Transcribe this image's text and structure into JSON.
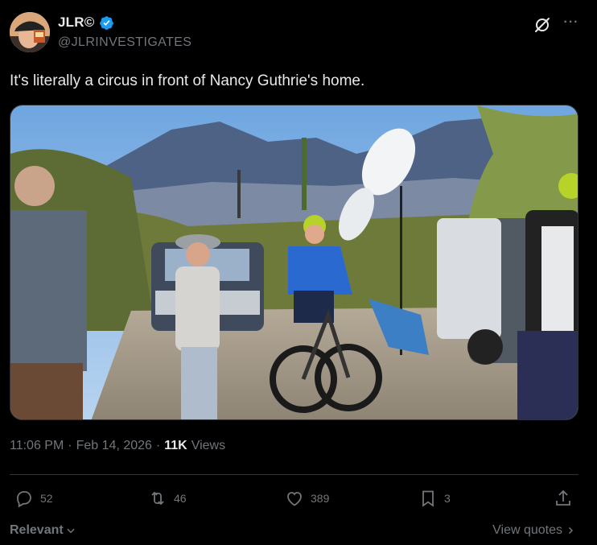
{
  "author": {
    "display_name": "JLR©",
    "handle": "@JLRINVESTIGATES",
    "verified": true,
    "avatar_icon": "avatar-photo"
  },
  "tweet": {
    "text": "It's literally a circus in front of Nancy Guthrie's home.",
    "media_icon": "photo-cyclist-road-media-crowd"
  },
  "meta": {
    "time": "11:06 PM",
    "separator1": "·",
    "date": "Feb 14, 2026",
    "separator2": "·",
    "views_count": "11K",
    "views_label": "Views"
  },
  "actions": {
    "replies": "52",
    "reposts": "46",
    "likes": "389",
    "bookmarks": "3"
  },
  "footer": {
    "sort_label": "Relevant",
    "view_quotes_label": "View quotes"
  },
  "colors": {
    "background": "#000000",
    "text_primary": "#e7e9ea",
    "text_secondary": "#71767b",
    "verified_blue": "#1d9bf0",
    "border": "#2f3336"
  }
}
